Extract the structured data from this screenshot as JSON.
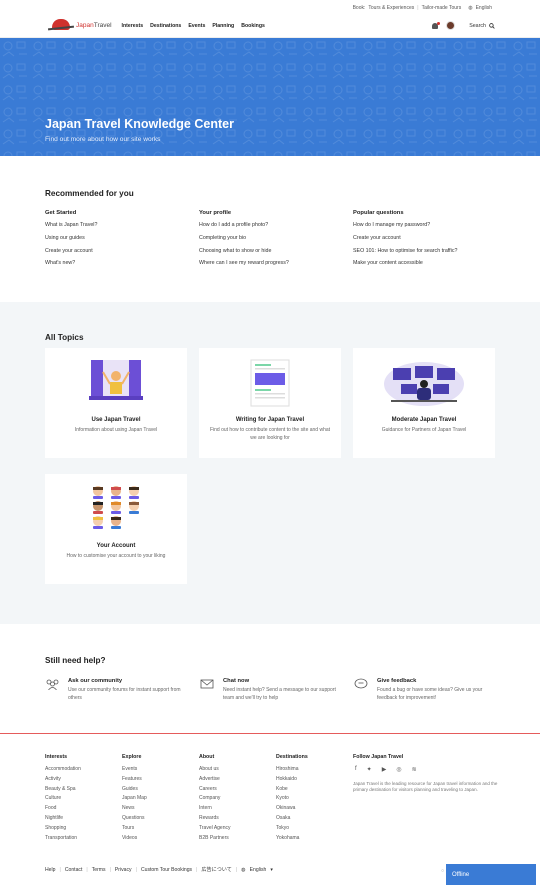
{
  "topbar": {
    "book": "Book:",
    "tours": "Tours & Experiences",
    "tailor": "Tailor-made Tours",
    "language": "English"
  },
  "nav": {
    "brand_red": "Japan",
    "brand_dark": "Travel",
    "links": [
      "Interests",
      "Destinations",
      "Events",
      "Planning",
      "Bookings"
    ],
    "search": "Search"
  },
  "hero": {
    "title": "Japan Travel Knowledge Center",
    "subtitle": "Find out more about how our site works",
    "color": "#3a7bd5"
  },
  "recommended": {
    "heading": "Recommended for you",
    "columns": [
      {
        "title": "Get Started",
        "items": [
          "What is Japan Travel?",
          "Using our guides",
          "Create your account",
          "What's new?"
        ]
      },
      {
        "title": "Your profile",
        "items": [
          "How do I add a profile photo?",
          "Completing your bio",
          "Choosing what to show or hide",
          "Where can I see my reward progress?"
        ]
      },
      {
        "title": "Popular questions",
        "items": [
          "How do I manage my password?",
          "Create your account",
          "SEO 101: How to optimise for search traffic?",
          "Make your content accessible"
        ]
      }
    ]
  },
  "topics": {
    "heading": "All Topics",
    "cards": [
      {
        "title": "Use Japan Travel",
        "desc": "Information about using Japan Travel"
      },
      {
        "title": "Writing for Japan Travel",
        "desc": "Find out how to contribute content to the site and what we are looking for"
      },
      {
        "title": "Moderate Japan Travel",
        "desc": "Guidance for Partners of Japan Travel"
      },
      {
        "title": "Your Account",
        "desc": "How to customise your account to your liking"
      }
    ]
  },
  "help": {
    "heading": "Still need help?",
    "items": [
      {
        "title": "Ask our community",
        "desc": "Use our community forums for instant support from others"
      },
      {
        "title": "Chat now",
        "desc": "Need instant help? Send a message to our support team and we'll try to help"
      },
      {
        "title": "Give feedback",
        "desc": "Found a bug or have some ideas? Give us your feedback for improvement!"
      }
    ]
  },
  "footer": {
    "columns": [
      {
        "title": "Interests",
        "items": [
          "Accommodation",
          "Activity",
          "Beauty & Spa",
          "Culture",
          "Food",
          "Nightlife",
          "Shopping",
          "Transportation"
        ]
      },
      {
        "title": "Explore",
        "items": [
          "Events",
          "Features",
          "Guides",
          "Japan Map",
          "News",
          "Questions",
          "Tours",
          "Videos"
        ]
      },
      {
        "title": "About",
        "items": [
          "About us",
          "Advertise",
          "Careers",
          "Company",
          "Intern",
          "Rewards",
          "Travel Agency",
          "B2B Partners"
        ]
      },
      {
        "title": "Destinations",
        "items": [
          "Hiroshima",
          "Hokkaido",
          "Kobe",
          "Kyoto",
          "Okinawa",
          "Osaka",
          "Tokyo",
          "Yokohama"
        ]
      }
    ],
    "follow": {
      "title": "Follow Japan Travel",
      "desc": "Japan Travel is the leading resource for Japan travel information and the primary destination for visitors planning and traveling to Japan."
    },
    "bottom_links": [
      "Help",
      "Contact",
      "Terms",
      "Privacy",
      "Custom Tour Bookings",
      "広告について"
    ],
    "language": "English"
  },
  "chat": {
    "status": "Offline"
  }
}
